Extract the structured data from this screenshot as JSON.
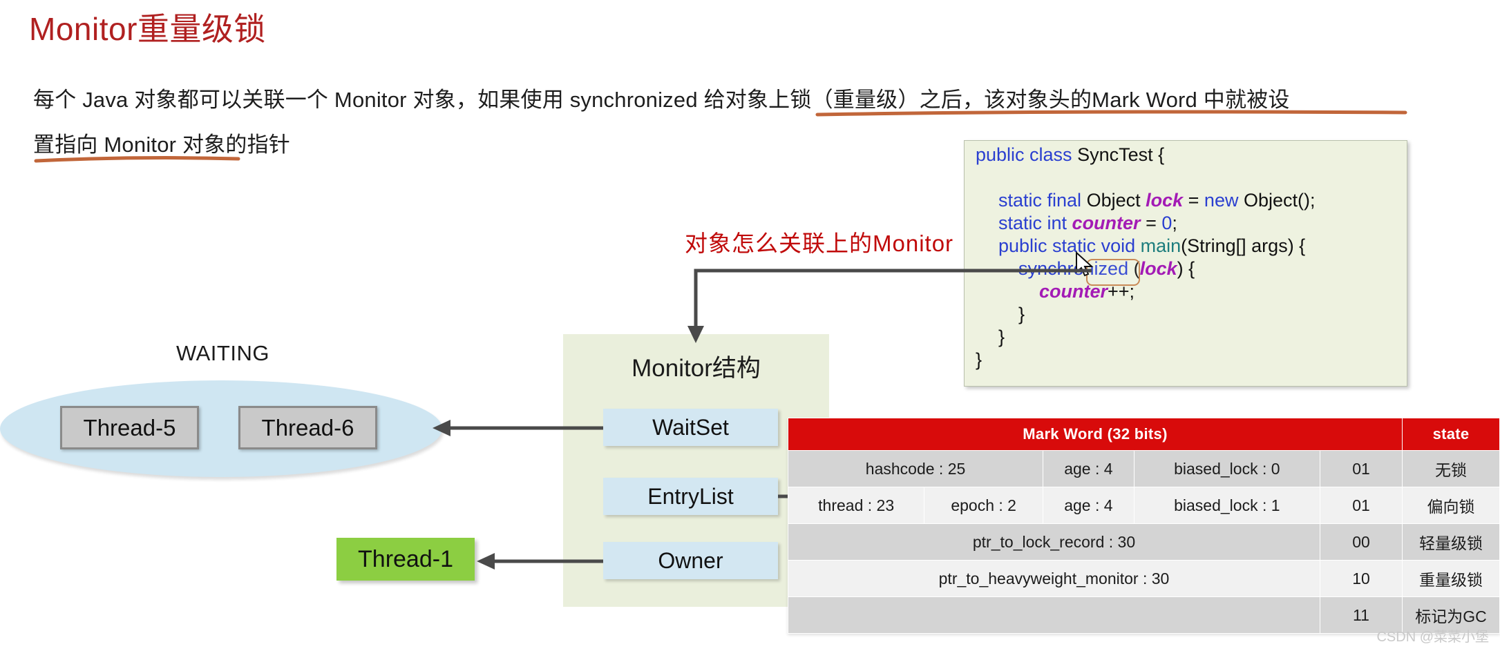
{
  "title": "Monitor重量级锁",
  "intro": {
    "line1": "每个 Java 对象都可以关联一个 Monitor 对象，如果使用 synchronized 给对象上锁（重量级）之后，该对象头的Mark Word 中就被设",
    "line2": "置指向 Monitor 对象的指针"
  },
  "annotation": "对象怎么关联上的Monitor",
  "code": {
    "line1_kw": "public class",
    "line1_rest": " SyncTest {",
    "line2_kw": "static final",
    "line2_type": " Object ",
    "line2_var": "lock",
    "line2_eq": " = ",
    "line2_new": "new",
    "line2_tail": " Object();",
    "line3_kw": "static int",
    "line3_var": " counter",
    "line3_eq": " = ",
    "line3_num": "0",
    "line3_semi": ";",
    "line4_kw": "public static void",
    "line4_meth": " main",
    "line4_tail": "(String[] args) {",
    "line5_kw": "synchronized",
    "line5_paren_open": " (",
    "line5_var": "lock",
    "line5_tail": ") {",
    "line6_var": "counter",
    "line6_tail": "++;",
    "line7": "}",
    "line8": "}",
    "line9": "}"
  },
  "monitor": {
    "title": "Monitor结构",
    "slots": [
      {
        "label": "WaitSet"
      },
      {
        "label": "EntryList"
      },
      {
        "label": "Owner"
      }
    ]
  },
  "waiting": {
    "label": "WAITING",
    "threads": [
      "Thread-5",
      "Thread-6"
    ]
  },
  "owner_thread": "Thread-1",
  "markword": {
    "headers": [
      "Mark Word (32 bits)",
      "state"
    ],
    "rows": [
      {
        "cells": [
          "hashcode : 25",
          "age : 4",
          "biased_lock : 0",
          "01"
        ],
        "state": "无锁"
      },
      {
        "cells": [
          "thread : 23",
          "epoch : 2",
          "age : 4",
          "biased_lock : 1",
          "01"
        ],
        "state": "偏向锁"
      },
      {
        "cells": [
          "ptr_to_lock_record : 30",
          "00"
        ],
        "state": "轻量级锁"
      },
      {
        "cells": [
          "ptr_to_heavyweight_monitor : 30",
          "10"
        ],
        "state": "重量级锁"
      },
      {
        "cells": [
          "",
          "11"
        ],
        "state": "标记为GC"
      }
    ]
  },
  "watermark": "CSDN @菜菜小堡",
  "colors": {
    "title_red": "#b02020",
    "annotation_red": "#c00a0a",
    "table_header_red": "#d80b0b",
    "monitor_bg": "#eaefdc",
    "slot_bg": "#d3e7f2",
    "ellipse_bg": "#cfe6f2",
    "owner_thread_green": "#8cce42",
    "underline_orange": "#c1663a",
    "code_bg": "#eef2e0"
  }
}
